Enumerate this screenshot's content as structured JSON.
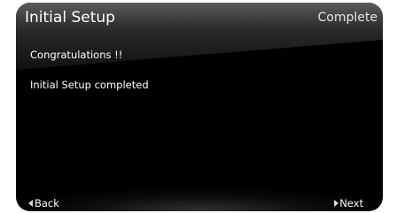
{
  "header": {
    "title": "Initial Setup",
    "status": "Complete"
  },
  "content": {
    "line1": "Congratulations !!",
    "line2": "Initial Setup completed"
  },
  "footer": {
    "back_label": "Back",
    "back_icon": "arrow-left-icon",
    "next_label": "Next",
    "next_icon": "arrow-right-icon"
  },
  "colors": {
    "background": "#000000",
    "text": "#ffffff",
    "header_top": "#5c5c5c"
  }
}
